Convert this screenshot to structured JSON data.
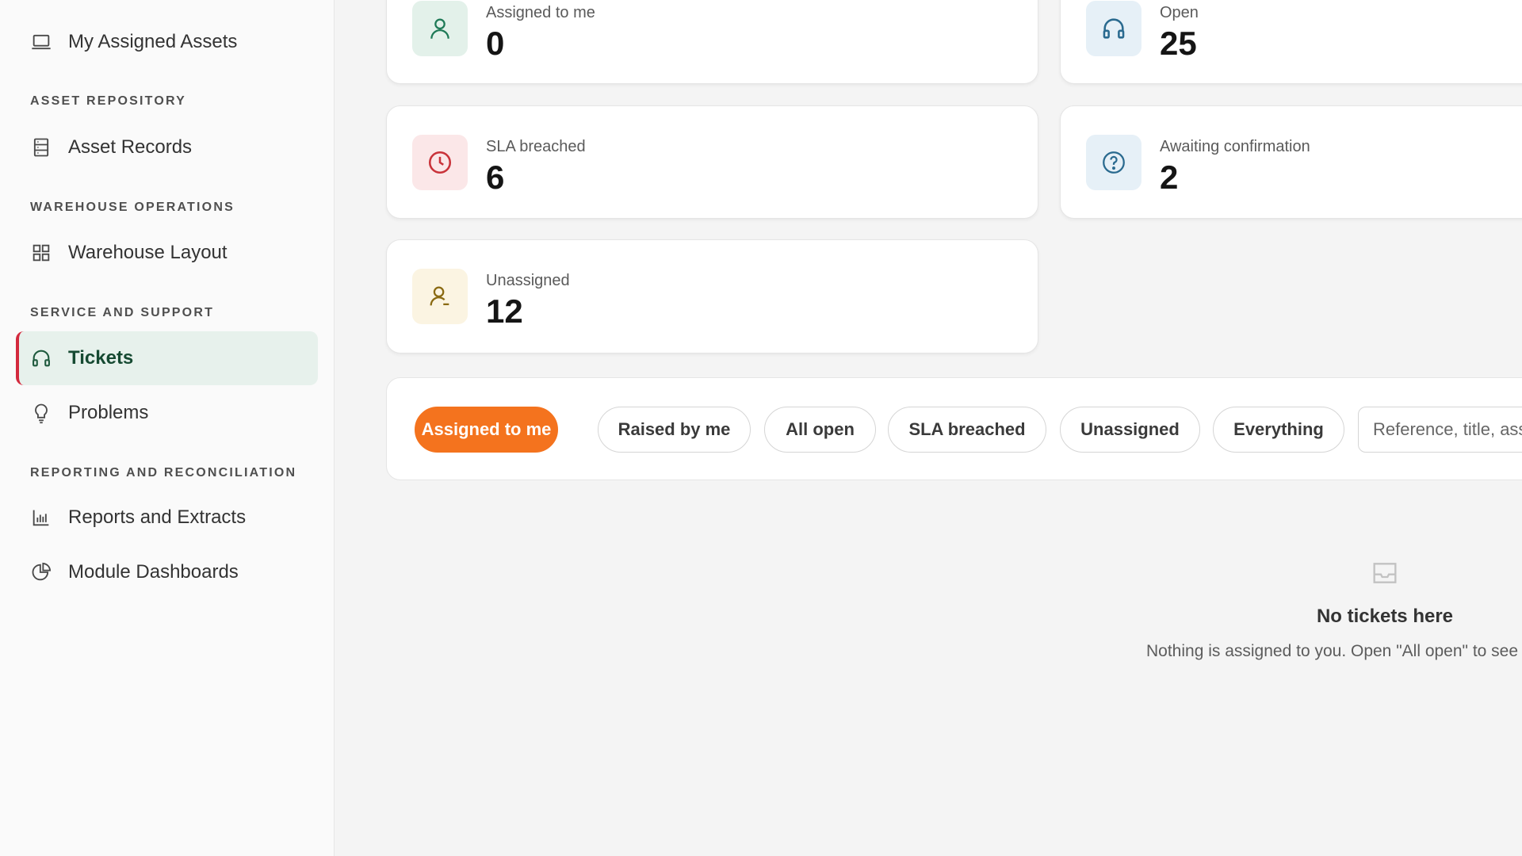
{
  "sidebar": {
    "items": [
      {
        "label": "My Assigned Assets",
        "icon": "laptop-icon"
      },
      {
        "label": "Asset Records",
        "icon": "records-icon"
      },
      {
        "label": "Warehouse Layout",
        "icon": "grid-icon"
      },
      {
        "label": "Tickets",
        "icon": "headset-icon",
        "active": true
      },
      {
        "label": "Problems",
        "icon": "lightbulb-icon"
      },
      {
        "label": "Reports and Extracts",
        "icon": "bar-chart-icon"
      },
      {
        "label": "Module Dashboards",
        "icon": "pie-chart-icon"
      }
    ],
    "sections": {
      "asset_repository": "ASSET REPOSITORY",
      "warehouse_operations": "WAREHOUSE OPERATIONS",
      "service_support": "SERVICE AND SUPPORT",
      "reporting": "REPORTING AND RECONCILIATION"
    },
    "active_accent": "#d3293d"
  },
  "stats": [
    {
      "label": "Assigned to me",
      "value": "0",
      "icon": "user-icon",
      "color": "#1f7a57",
      "bg": "#e3f1ea"
    },
    {
      "label": "Open",
      "value": "25",
      "icon": "headset-icon",
      "color": "#2a6a8f",
      "bg": "#e6f0f7"
    },
    {
      "label": "SLA breached",
      "value": "6",
      "icon": "clock-icon",
      "color": "#c9333a",
      "bg": "#fbe7e8"
    },
    {
      "label": "Awaiting confirmation",
      "value": "2",
      "icon": "question-circle-icon",
      "color": "#2a6a8f",
      "bg": "#e6f0f7"
    },
    {
      "label": "Unassigned",
      "value": "12",
      "icon": "user-minus-icon",
      "color": "#8a6a12",
      "bg": "#fbf4e2"
    }
  ],
  "filters": {
    "pills": [
      "Assigned to me",
      "Raised by me",
      "All open",
      "SLA breached",
      "Unassigned",
      "Everything"
    ],
    "active_index": 0,
    "active_color": "#f4731e",
    "search_placeholder": "Reference, title, ass"
  },
  "empty_state": {
    "title": "No tickets here",
    "description": "Nothing is assigned to you. Open \"All open\" to see the",
    "icon": "inbox-icon"
  }
}
